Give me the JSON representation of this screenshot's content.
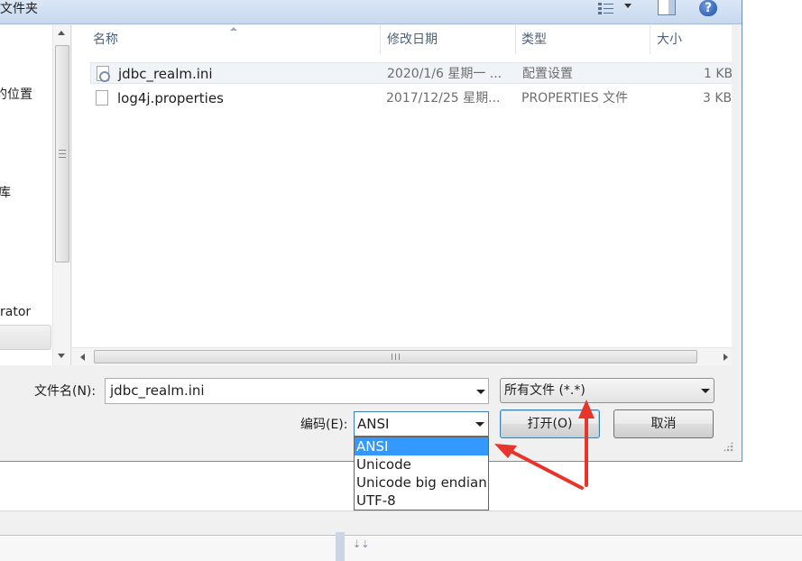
{
  "dialog": {
    "title_fragment": "建文件夹"
  },
  "nav": {
    "items": [
      {
        "label": "的位置"
      },
      {
        "label": "库"
      },
      {
        "label": "rator"
      }
    ]
  },
  "columns": {
    "name": "名称",
    "date": "修改日期",
    "type": "类型",
    "size": "大小"
  },
  "files": [
    {
      "name": "jdbc_realm.ini",
      "date": "2020/1/6 星期一 ...",
      "type": "配置设置",
      "size": "1 KB"
    },
    {
      "name": "log4j.properties",
      "date": "2017/12/25 星期...",
      "type": "PROPERTIES 文件",
      "size": "3 KB"
    }
  ],
  "filename": {
    "label": "文件名(N):",
    "value": "jdbc_realm.ini"
  },
  "filetype": {
    "value": "所有文件  (*.*)"
  },
  "encoding": {
    "label": "编码(E):",
    "value": "ANSI",
    "options": [
      "ANSI",
      "Unicode",
      "Unicode big endian",
      "UTF-8"
    ]
  },
  "buttons": {
    "open": "打开(O)",
    "cancel": "取消"
  },
  "icons": {
    "help": "?",
    "grip": "⇣⇣"
  },
  "colors": {
    "selection": "#3399ff",
    "annotation": "#e8352b"
  }
}
